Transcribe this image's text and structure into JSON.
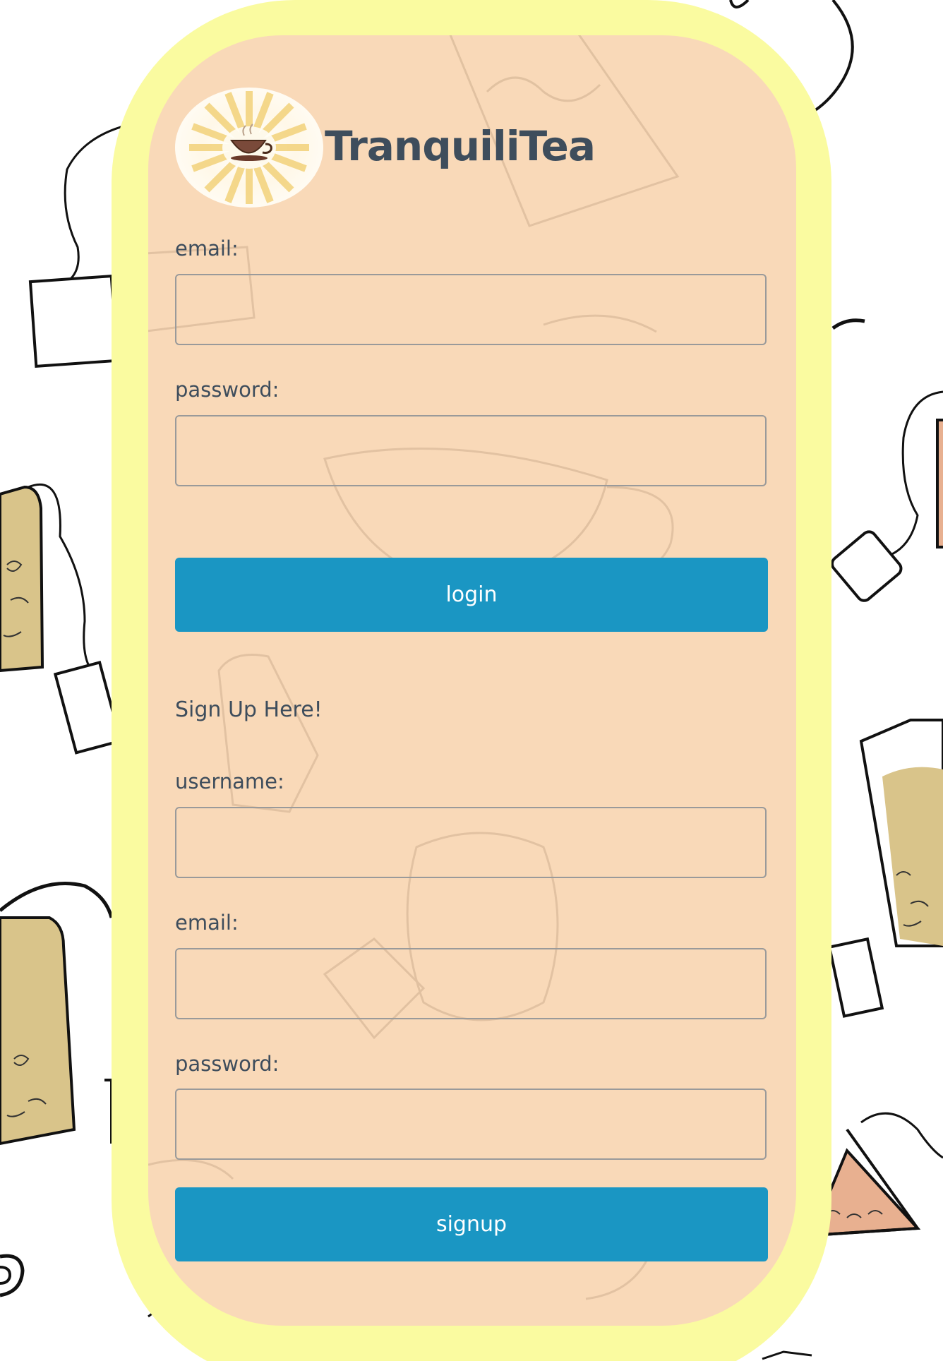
{
  "app": {
    "title": "TranquiliTea",
    "logo_icon": "tea-cup-sunburst-icon"
  },
  "login_form": {
    "email_label": "email:",
    "email_value": "",
    "password_label": "password:",
    "password_value": "",
    "submit_label": "login"
  },
  "signup_form": {
    "heading": "Sign Up Here!",
    "username_label": "username:",
    "username_value": "",
    "email_label": "email:",
    "email_value": "",
    "password_label": "password:",
    "password_value": "",
    "submit_label": "signup"
  },
  "colors": {
    "outer_frame": "#fafba0",
    "card": "#f9d9b8",
    "button": "#1a96c3",
    "text": "#3e4d5c"
  }
}
